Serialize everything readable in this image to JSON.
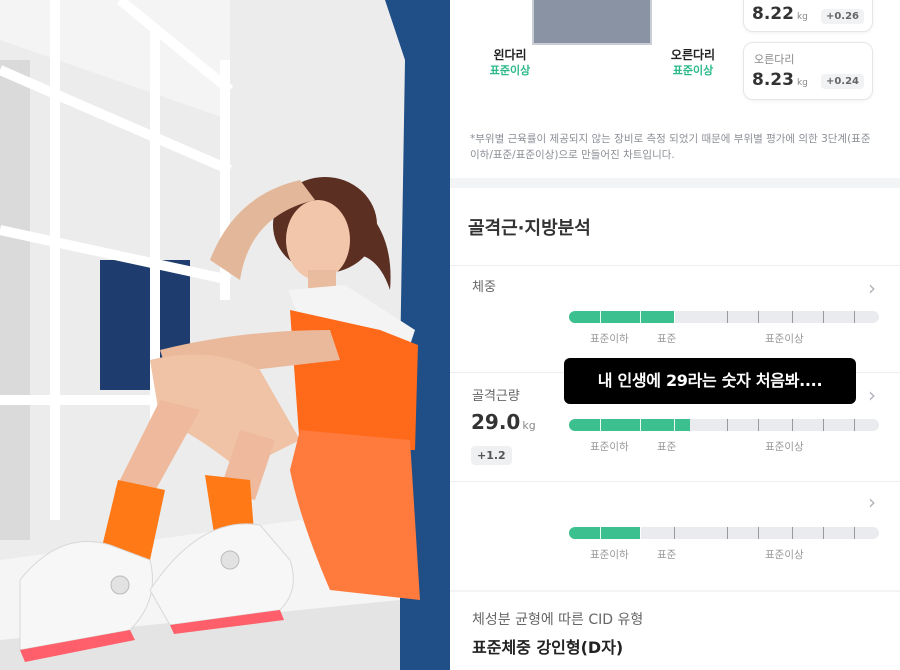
{
  "legs": {
    "left": {
      "label": "왼다리",
      "status": "표준이상"
    },
    "right": {
      "label": "오른다리",
      "status": "표준이상"
    }
  },
  "cards": {
    "top": {
      "value": "8.22",
      "unit": "kg",
      "delta": "+0.26"
    },
    "right_leg": {
      "label": "오른다리",
      "value": "8.23",
      "unit": "kg",
      "delta": "+0.24"
    }
  },
  "note": "*부위별 근육률이 제공되지 않는 장비로 측정 되었기 때문에 부위별 평가에 의한 3단계(표준이하/표준/표준이상)으로 만들어진 차트입니다.",
  "section_title": "골격근·지방분석",
  "metrics": [
    {
      "label": "체중",
      "value": "",
      "unit": "",
      "delta": "",
      "fill_fraction": 0.34
    },
    {
      "label": "골격근량",
      "value": "29.0",
      "unit": "kg",
      "delta": "+1.2",
      "fill_fraction": 0.39
    },
    {
      "label": "",
      "value": "",
      "unit": "",
      "delta": "",
      "fill_fraction": 0.23
    }
  ],
  "scale_labels": {
    "low": "표준이하",
    "mid": "표준",
    "high": "표준이상"
  },
  "caption": "내 인생에 29라는 숫자 처음봐....",
  "cid": {
    "label": "체성분 균형에 따른 CID 유형",
    "value": "표준체중 강인형(D자)"
  },
  "colors": {
    "accent": "#3cc08f",
    "status": "#2cb98a"
  }
}
